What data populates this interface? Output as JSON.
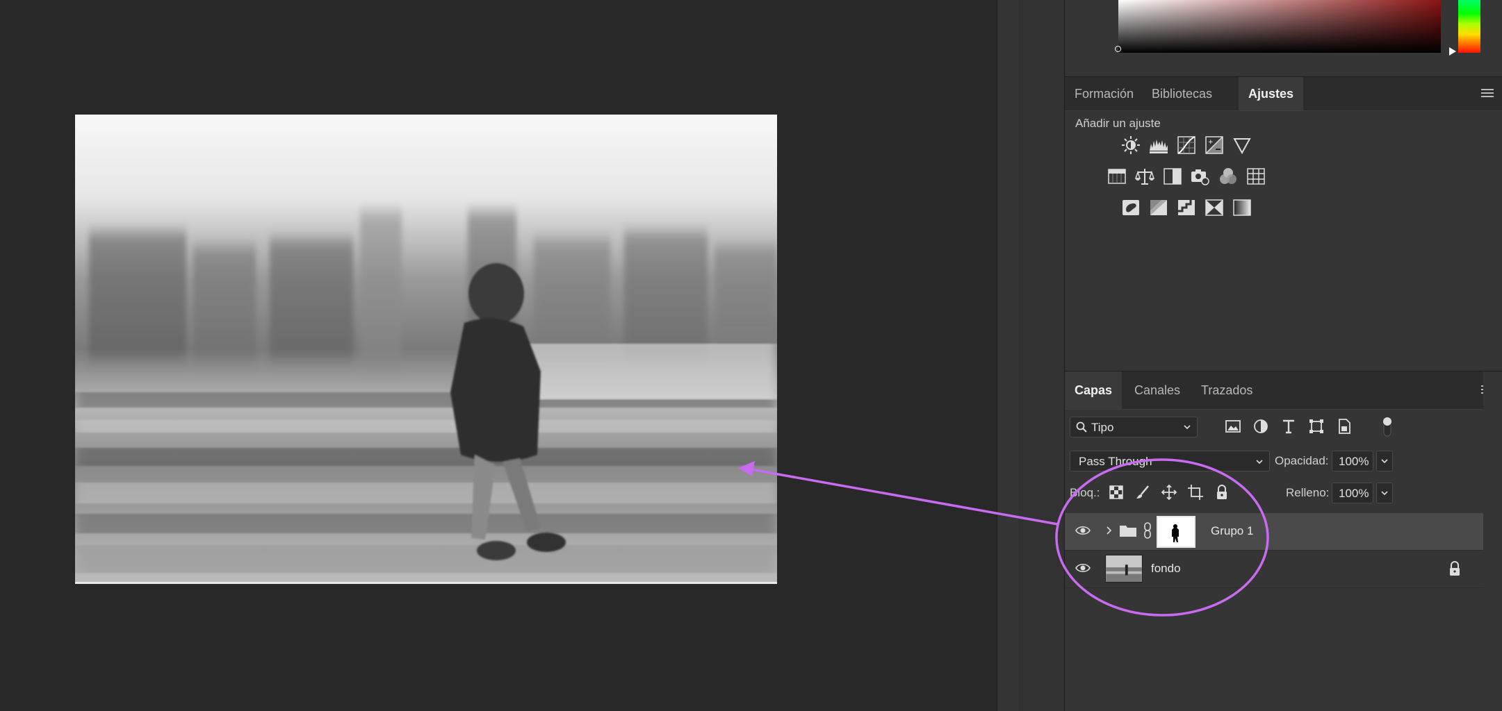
{
  "adjustments_tabs": {
    "tab1": "Formación",
    "tab2": "Bibliotecas",
    "tab3": "Ajustes",
    "active": "Ajustes"
  },
  "adjustments": {
    "heading": "Añadir un ajuste",
    "icons": [
      "brightness-contrast-icon",
      "levels-icon",
      "curves-icon",
      "exposure-icon",
      "vibrance-icon",
      "hue-saturation-icon",
      "color-balance-icon",
      "black-white-icon",
      "photo-filter-icon",
      "channel-mixer-icon",
      "color-lookup-icon",
      "invert-icon",
      "posterize-icon",
      "threshold-icon",
      "selective-color-icon",
      "gradient-map-icon"
    ]
  },
  "layers_tabs": {
    "tab1": "Capas",
    "tab2": "Canales",
    "tab3": "Trazados",
    "active": "Capas"
  },
  "layers": {
    "filter_label": "Tipo",
    "blend_mode": "Pass Through",
    "opacity_label": "Opacidad:",
    "opacity_value": "100%",
    "lock_label": "Bloq.:",
    "fill_label": "Relleno:",
    "fill_value": "100%",
    "rows": [
      {
        "name": "Grupo 1",
        "type": "group",
        "visible": true,
        "selected": true,
        "has_mask": true
      },
      {
        "name": "fondo",
        "type": "pixel",
        "visible": true,
        "selected": false,
        "locked": true
      }
    ]
  },
  "colors": {
    "annotation": "#c86bf0",
    "panel_bg": "#353535",
    "canvas_bg": "#282828"
  }
}
